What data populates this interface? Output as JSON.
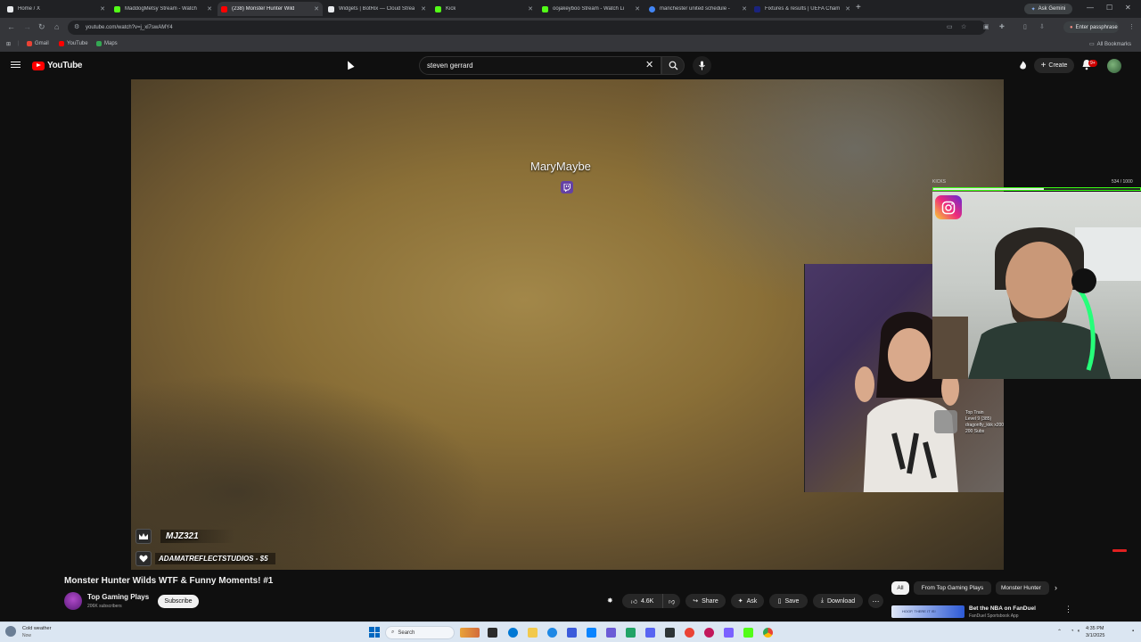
{
  "browser": {
    "tabs": [
      {
        "label": "Home / X",
        "color": "#e8eaed"
      },
      {
        "label": "MaddogMetsy Stream - Watch",
        "color": "#53fc18"
      },
      {
        "label": "(238) Monster Hunter Wild",
        "color": "#ff0000"
      },
      {
        "label": "Widgets | BotRix — Cloud Strea",
        "color": "#e8eaed"
      },
      {
        "label": "Kick",
        "color": "#53fc18"
      },
      {
        "label": "oojakeyboo Stream - Watch Li",
        "color": "#53fc18"
      },
      {
        "label": "manchester united schedule - ",
        "color": "#4285f4"
      },
      {
        "label": "Fixtures & results | UEFA Cham",
        "color": "#1a237e"
      }
    ],
    "ask_gemini": "Ask Gemini",
    "url": "youtube.com/watch?v=j_xl7swAMY4",
    "enter_passphrase": "Enter passphrase",
    "bookmarks": [
      "Gmail",
      "YouTube",
      "Maps"
    ],
    "all_bookmarks": "All Bookmarks"
  },
  "youtube": {
    "logo_text": "YouTube",
    "search_value": "steven gerrard",
    "create_label": "Create",
    "notif_count": "9+"
  },
  "video": {
    "overlay_name": "MaryMaybe",
    "donation_1": "MJZ321",
    "donation_2": "ADAMATREFLECTSTUDIOS - $5",
    "kicks_label": "KICKS",
    "kicks_count": "534 / 1000",
    "kicks_progress": 0.534,
    "sub_goal_lines": [
      "Top Train",
      "Level 9 (385)",
      "dragonfly_kkk x200",
      "200 Subs"
    ]
  },
  "below": {
    "title": "Monster Hunter Wilds WTF & Funny Moments! #1",
    "channel_name": "Top Gaming Plays",
    "channel_subs": "206K subscribers",
    "subscribe": "Subscribe",
    "likes": "4.6K",
    "share": "Share",
    "ask": "Ask",
    "save": "Save",
    "download": "Download"
  },
  "rail": {
    "chips": [
      "All",
      "From Top Gaming Plays",
      "Monster Hunter"
    ],
    "ad_thumb_text": "HOOP, THERE IT IS!",
    "ad_title": "Bet the NBA on FanDuel",
    "ad_sub": "FanDuel Sportsbook App"
  },
  "taskbar": {
    "weather_title": "Cold weather",
    "weather_sub": "Now",
    "search": "Search",
    "time": "4:35 PM",
    "date": "3/1/2025"
  }
}
